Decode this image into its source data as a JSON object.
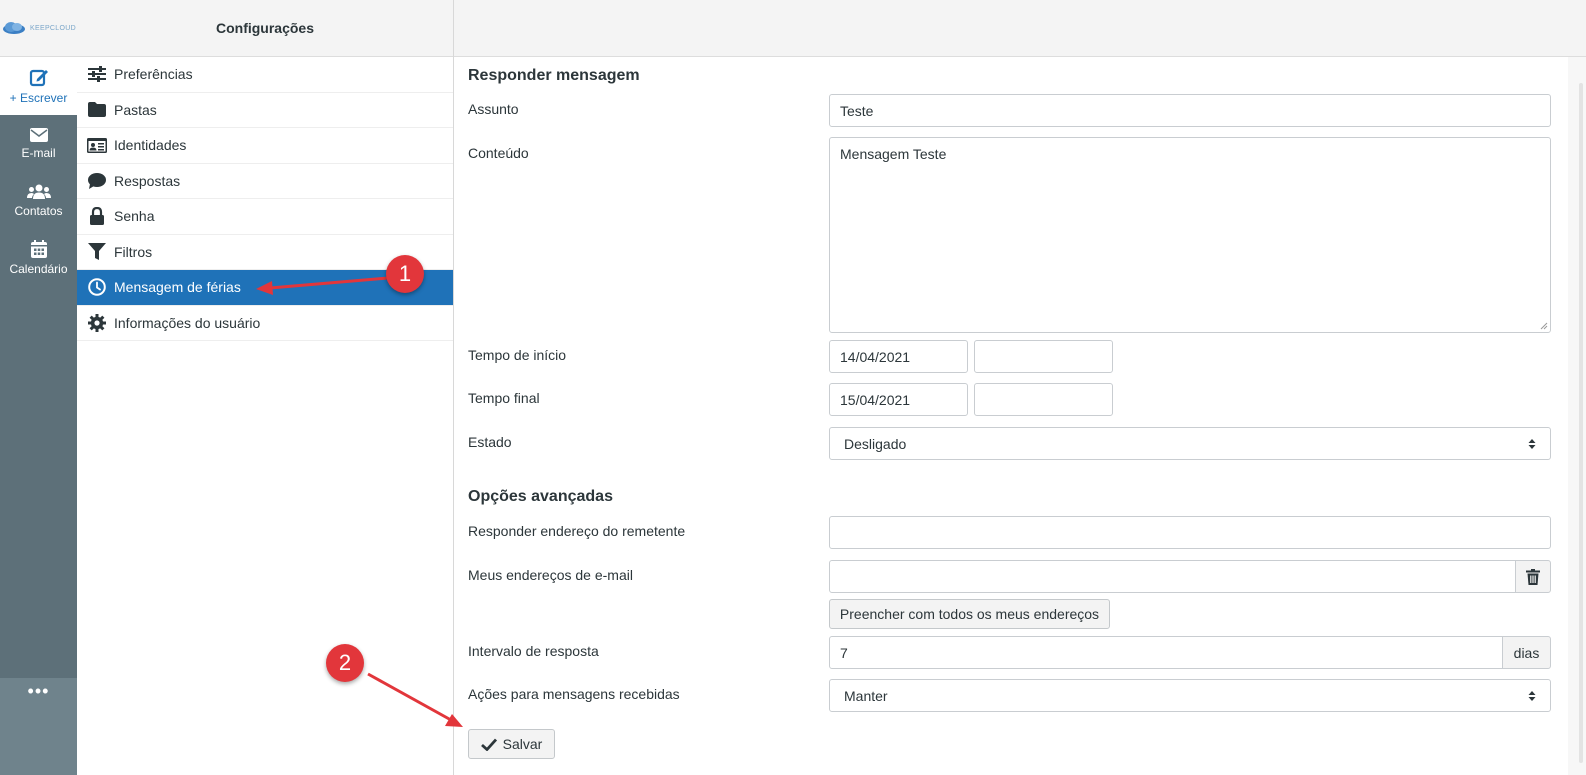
{
  "brand": {
    "logo_text": "KEEPCLOUD"
  },
  "rail": {
    "compose_label": "+ Escrever",
    "items": [
      {
        "label": "E-mail",
        "icon": "envelope-icon"
      },
      {
        "label": "Contatos",
        "icon": "users-icon"
      },
      {
        "label": "Calendário",
        "icon": "calendar-icon"
      }
    ],
    "more_label": "•••"
  },
  "settings": {
    "title": "Configurações",
    "items": [
      {
        "label": "Preferências",
        "icon": "sliders-icon"
      },
      {
        "label": "Pastas",
        "icon": "folder-icon"
      },
      {
        "label": "Identidades",
        "icon": "id-card-icon"
      },
      {
        "label": "Respostas",
        "icon": "comment-icon"
      },
      {
        "label": "Senha",
        "icon": "lock-icon"
      },
      {
        "label": "Filtros",
        "icon": "filter-icon"
      },
      {
        "label": "Mensagem de férias",
        "icon": "clock-icon",
        "active": true
      },
      {
        "label": "Informações do usuário",
        "icon": "gear-icon"
      }
    ]
  },
  "form": {
    "reply_title": "Responder mensagem",
    "subject_label": "Assunto",
    "subject_value": "Teste",
    "content_label": "Conteúdo",
    "content_value": "Mensagem Teste",
    "start_label": "Tempo de início",
    "start_date": "14/04/2021",
    "start_time": "",
    "end_label": "Tempo final",
    "end_date": "15/04/2021",
    "end_time": "",
    "state_label": "Estado",
    "state_value": "Desligado",
    "advanced_title": "Opções avançadas",
    "sender_label": "Responder endereço do remetente",
    "sender_value": "",
    "my_addresses_label": "Meus endereços de e-mail",
    "my_addresses_value": "",
    "fill_button": "Preencher com todos os meus endereços",
    "interval_label": "Intervalo de resposta",
    "interval_value": "7",
    "interval_unit": "dias",
    "actions_label": "Ações para mensagens recebidas",
    "actions_value": "Manter",
    "save_button": "Salvar"
  },
  "annotations": {
    "one": "1",
    "two": "2"
  },
  "colors": {
    "accent": "#1f72b8",
    "rail": "#5d7079",
    "annotation": "#e2363b"
  }
}
